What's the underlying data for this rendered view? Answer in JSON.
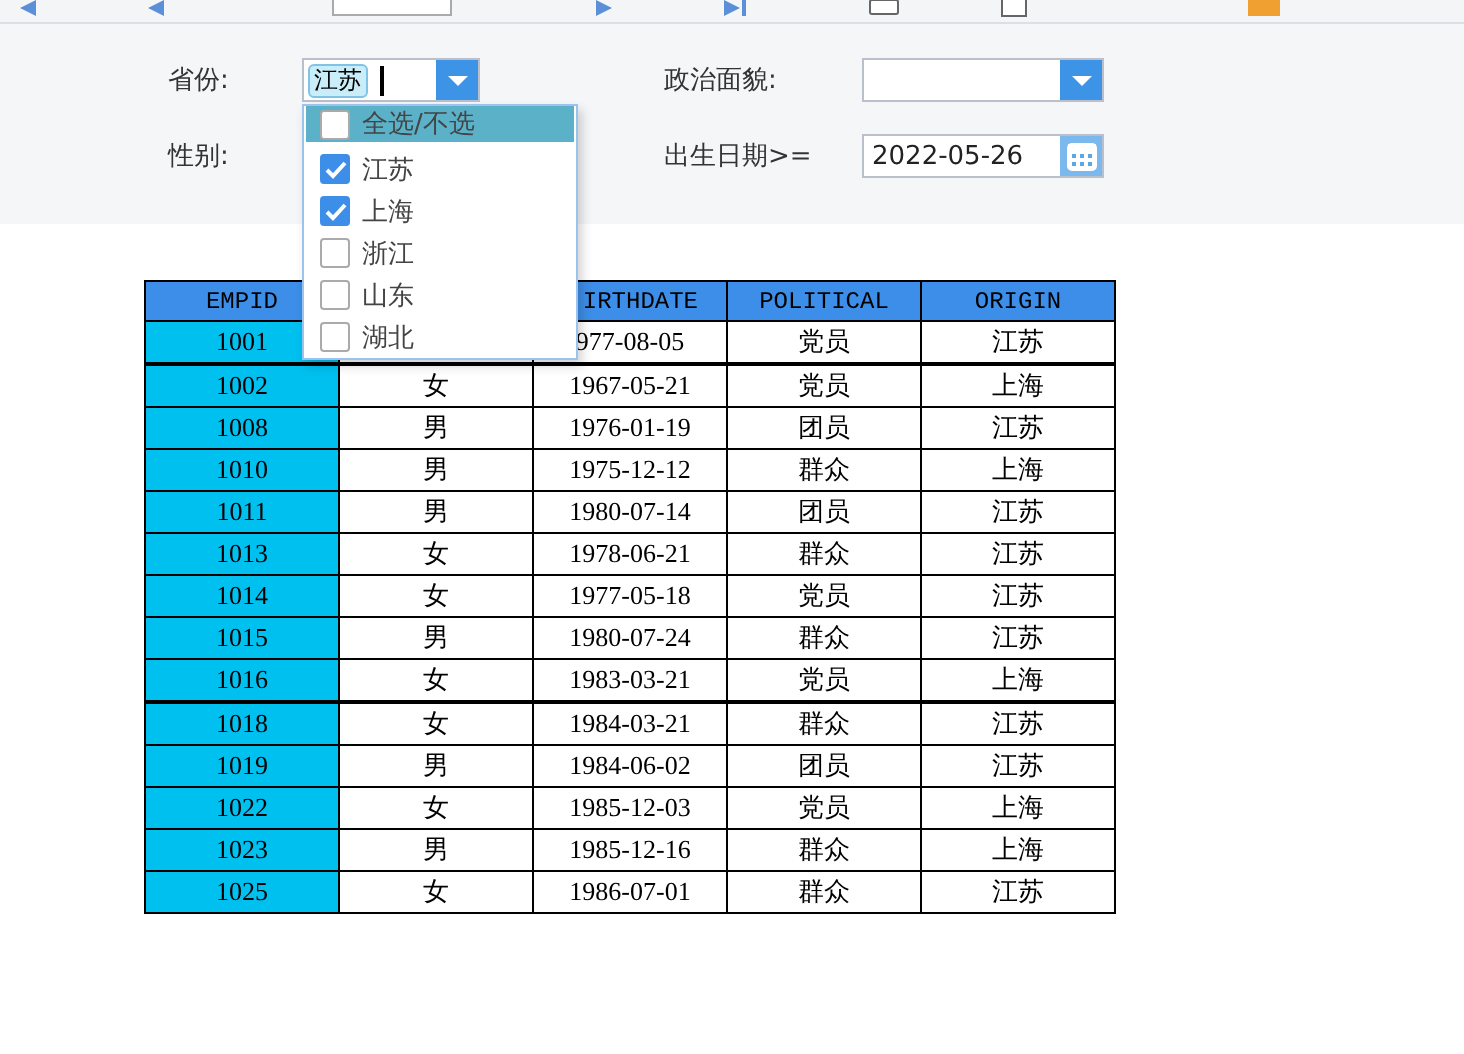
{
  "filters": {
    "province": {
      "label": "省份:",
      "tags": [
        "江苏"
      ]
    },
    "gender": {
      "label": "性别:"
    },
    "political": {
      "label": "政治面貌:"
    },
    "birthdate": {
      "label": "出生日期>=",
      "value": "2022-05-26"
    }
  },
  "province_dropdown": {
    "items": [
      {
        "label": "全选/不选",
        "checked": false,
        "selected": true
      },
      {
        "label": "江苏",
        "checked": true,
        "selected": false
      },
      {
        "label": "上海",
        "checked": true,
        "selected": false
      },
      {
        "label": "浙江",
        "checked": false,
        "selected": false
      },
      {
        "label": "山东",
        "checked": false,
        "selected": false
      },
      {
        "label": "湖北",
        "checked": false,
        "selected": false
      }
    ]
  },
  "table": {
    "columns": [
      "EMPID",
      null,
      "IRTHDATE",
      "POLITICAL",
      "ORIGIN"
    ],
    "rows": [
      {
        "cells": [
          "1001",
          null,
          "977-08-05",
          "党员",
          "江苏"
        ],
        "separator_after": true
      },
      {
        "cells": [
          "1002",
          "女",
          "1967-05-21",
          "党员",
          "上海"
        ],
        "separator_after": false
      },
      {
        "cells": [
          "1008",
          "男",
          "1976-01-19",
          "团员",
          "江苏"
        ],
        "separator_after": false
      },
      {
        "cells": [
          "1010",
          "男",
          "1975-12-12",
          "群众",
          "上海"
        ],
        "separator_after": false
      },
      {
        "cells": [
          "1011",
          "男",
          "1980-07-14",
          "团员",
          "江苏"
        ],
        "separator_after": false
      },
      {
        "cells": [
          "1013",
          "女",
          "1978-06-21",
          "群众",
          "江苏"
        ],
        "separator_after": false
      },
      {
        "cells": [
          "1014",
          "女",
          "1977-05-18",
          "党员",
          "江苏"
        ],
        "separator_after": false
      },
      {
        "cells": [
          "1015",
          "男",
          "1980-07-24",
          "群众",
          "江苏"
        ],
        "separator_after": false
      },
      {
        "cells": [
          "1016",
          "女",
          "1983-03-21",
          "党员",
          "上海"
        ],
        "separator_after": true
      },
      {
        "cells": [
          "1018",
          "女",
          "1984-03-21",
          "群众",
          "江苏"
        ],
        "separator_after": false
      },
      {
        "cells": [
          "1019",
          "男",
          "1984-06-02",
          "团员",
          "江苏"
        ],
        "separator_after": false
      },
      {
        "cells": [
          "1022",
          "女",
          "1985-12-03",
          "党员",
          "上海"
        ],
        "separator_after": false
      },
      {
        "cells": [
          "1023",
          "男",
          "1985-12-16",
          "群众",
          "上海"
        ],
        "separator_after": false
      },
      {
        "cells": [
          "1025",
          "女",
          "1986-07-01",
          "群众",
          "江苏"
        ],
        "separator_after": false
      }
    ]
  }
}
